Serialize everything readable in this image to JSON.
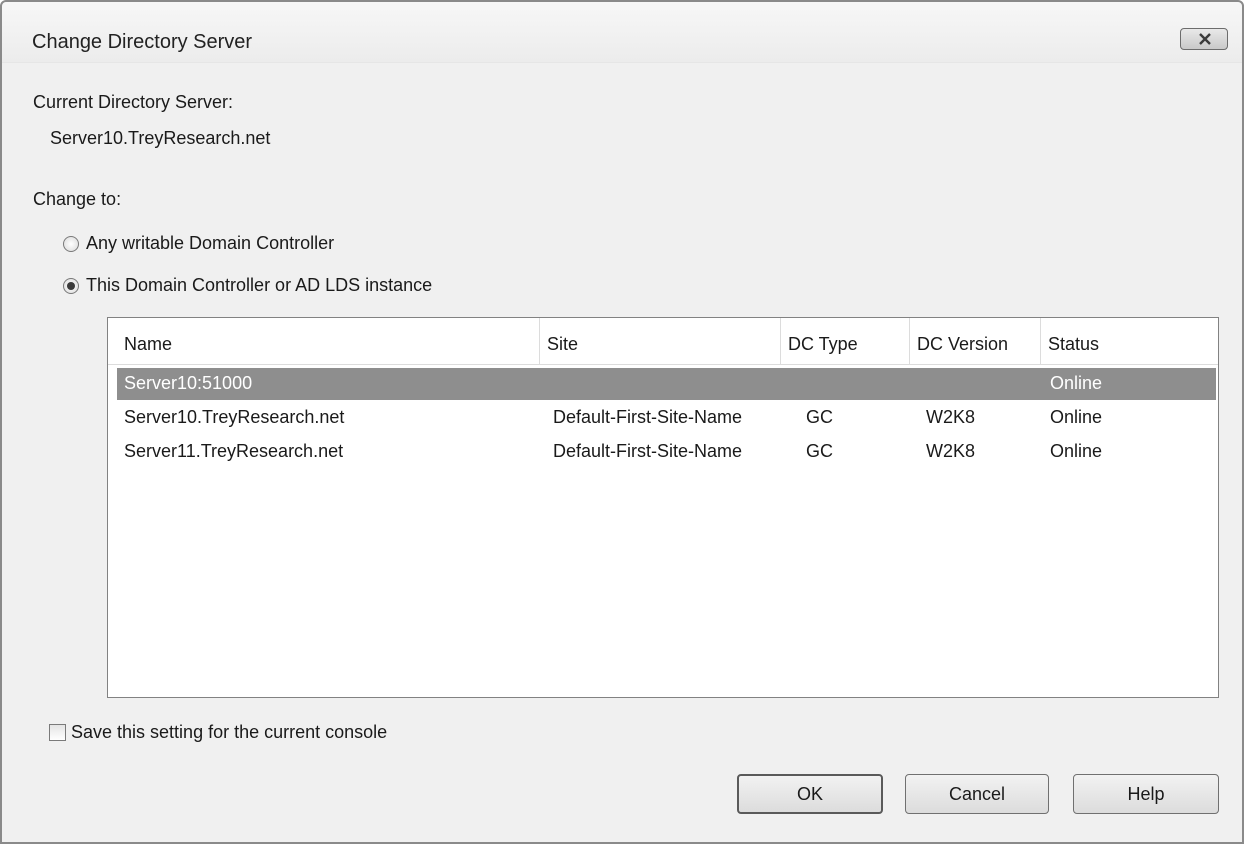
{
  "window": {
    "title": "Change Directory Server",
    "close_icon": "close-x-icon"
  },
  "current": {
    "label": "Current Directory Server:",
    "value": "Server10.TreyResearch.net"
  },
  "change_to": {
    "label": "Change to:",
    "options": [
      {
        "label": "Any writable Domain Controller",
        "selected": false
      },
      {
        "label": "This Domain Controller or AD LDS instance",
        "selected": true
      }
    ]
  },
  "servers": {
    "columns": [
      "Name",
      "Site",
      "DC Type",
      "DC Version",
      "Status"
    ],
    "rows": [
      {
        "name": "Server10:51000",
        "site": "",
        "dc_type": "",
        "dc_version": "",
        "status": "Online",
        "selected": true
      },
      {
        "name": "Server10.TreyResearch.net",
        "site": "Default-First-Site-Name",
        "dc_type": "GC",
        "dc_version": "W2K8",
        "status": "Online",
        "selected": false
      },
      {
        "name": "Server11.TreyResearch.net",
        "site": "Default-First-Site-Name",
        "dc_type": "GC",
        "dc_version": "W2K8",
        "status": "Online",
        "selected": false
      }
    ]
  },
  "save_setting": {
    "label": "Save this setting for the current console",
    "checked": false
  },
  "buttons": {
    "ok": "OK",
    "cancel": "Cancel",
    "help": "Help"
  },
  "colors": {
    "dialog_bg": "#f0f0f0",
    "selection_bg": "#8e8e8e"
  }
}
